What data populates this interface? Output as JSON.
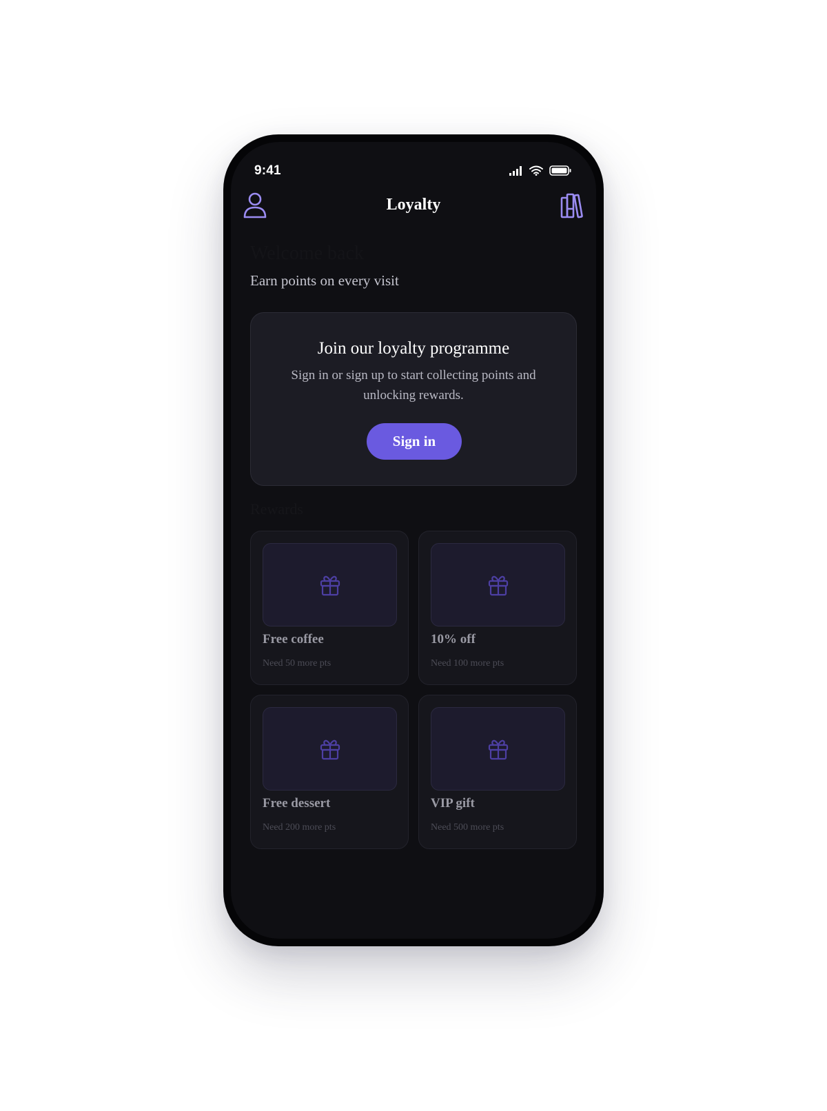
{
  "status_bar": {
    "time": "9:41"
  },
  "header": {
    "title": "Loyalty",
    "left_icon": "user-icon",
    "right_icon": "library-icon"
  },
  "welcome": {
    "heading": "Welcome back",
    "subtitle": "Earn points on every visit"
  },
  "join_card": {
    "title": "Join our loyalty programme",
    "text": "Sign in or sign up to start collecting points and unlocking rewards.",
    "button_label": "Sign in"
  },
  "rewards_section": {
    "label": "Rewards",
    "items": [
      {
        "name": "Free coffee",
        "need": "Need 50 more pts",
        "icon": "gift-icon"
      },
      {
        "name": "10% off",
        "need": "Need 100 more pts",
        "icon": "gift-icon"
      },
      {
        "name": "Free dessert",
        "need": "Need 200 more pts",
        "icon": "gift-icon"
      },
      {
        "name": "VIP gift",
        "need": "Need 500 more pts",
        "icon": "gift-icon"
      }
    ]
  },
  "colors": {
    "background": "#0f0f13",
    "accent": "#6a5ae0",
    "icon_accent": "#9b8cf2",
    "card": "#1c1c24"
  }
}
